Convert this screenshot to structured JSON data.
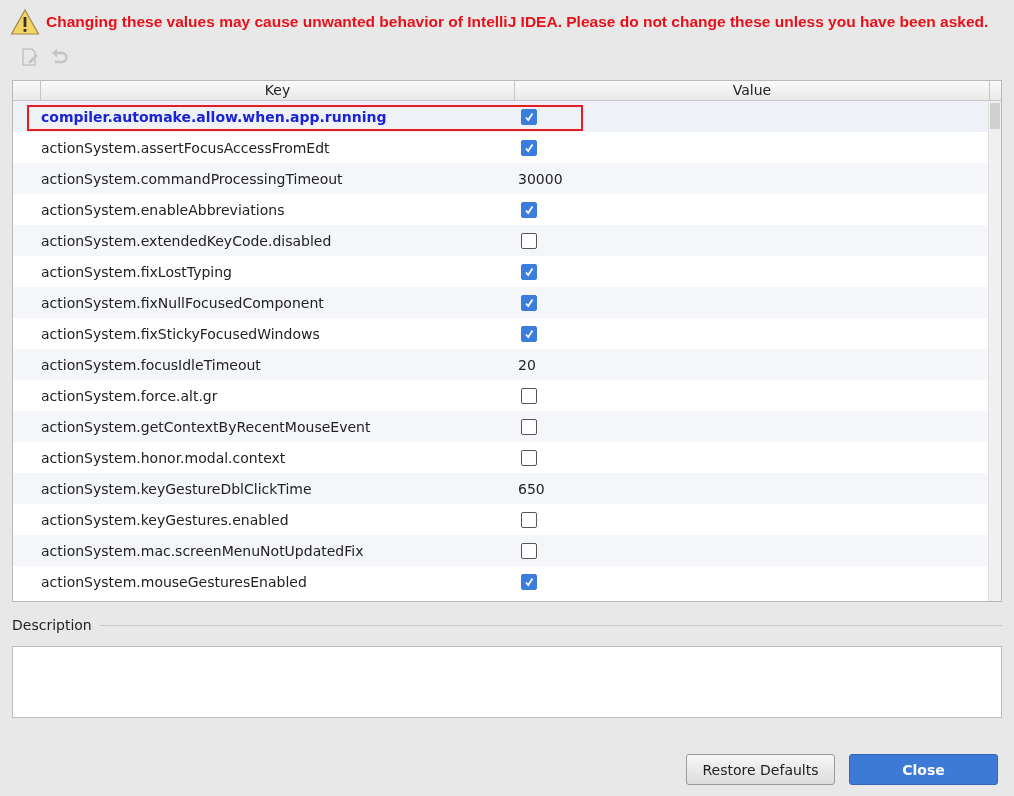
{
  "warning": {
    "text": "Changing these values may cause unwanted behavior of IntelliJ IDEA. Please do not change these unless you have been asked."
  },
  "toolbar": [
    {
      "kind": "edit",
      "disabled": true
    },
    {
      "kind": "undo",
      "disabled": true
    }
  ],
  "table": {
    "columns": [
      "Key",
      "Value"
    ],
    "rows": [
      {
        "key": "compiler.automake.allow.when.app.running",
        "kind": "bool",
        "checked": true,
        "selected": true
      },
      {
        "key": "actionSystem.assertFocusAccessFromEdt",
        "kind": "bool",
        "checked": true,
        "selected": false
      },
      {
        "key": "actionSystem.commandProcessingTimeout",
        "kind": "text",
        "value": "30000",
        "selected": false
      },
      {
        "key": "actionSystem.enableAbbreviations",
        "kind": "bool",
        "checked": true,
        "selected": false
      },
      {
        "key": "actionSystem.extendedKeyCode.disabled",
        "kind": "bool",
        "checked": false,
        "selected": false
      },
      {
        "key": "actionSystem.fixLostTyping",
        "kind": "bool",
        "checked": true,
        "selected": false
      },
      {
        "key": "actionSystem.fixNullFocusedComponent",
        "kind": "bool",
        "checked": true,
        "selected": false
      },
      {
        "key": "actionSystem.fixStickyFocusedWindows",
        "kind": "bool",
        "checked": true,
        "selected": false
      },
      {
        "key": "actionSystem.focusIdleTimeout",
        "kind": "text",
        "value": "20",
        "selected": false
      },
      {
        "key": "actionSystem.force.alt.gr",
        "kind": "bool",
        "checked": false,
        "selected": false
      },
      {
        "key": "actionSystem.getContextByRecentMouseEvent",
        "kind": "bool",
        "checked": false,
        "selected": false
      },
      {
        "key": "actionSystem.honor.modal.context",
        "kind": "bool",
        "checked": false,
        "selected": false
      },
      {
        "key": "actionSystem.keyGestureDblClickTime",
        "kind": "text",
        "value": "650",
        "selected": false
      },
      {
        "key": "actionSystem.keyGestures.enabled",
        "kind": "bool",
        "checked": false,
        "selected": false
      },
      {
        "key": "actionSystem.mac.screenMenuNotUpdatedFix",
        "kind": "bool",
        "checked": false,
        "selected": false
      },
      {
        "key": "actionSystem.mouseGesturesEnabled",
        "kind": "bool",
        "checked": true,
        "selected": false
      }
    ]
  },
  "description": {
    "label": "Description"
  },
  "buttons": [
    {
      "label": "Restore Defaults",
      "kind": "secondary"
    },
    {
      "label": "Close",
      "kind": "primary"
    }
  ]
}
